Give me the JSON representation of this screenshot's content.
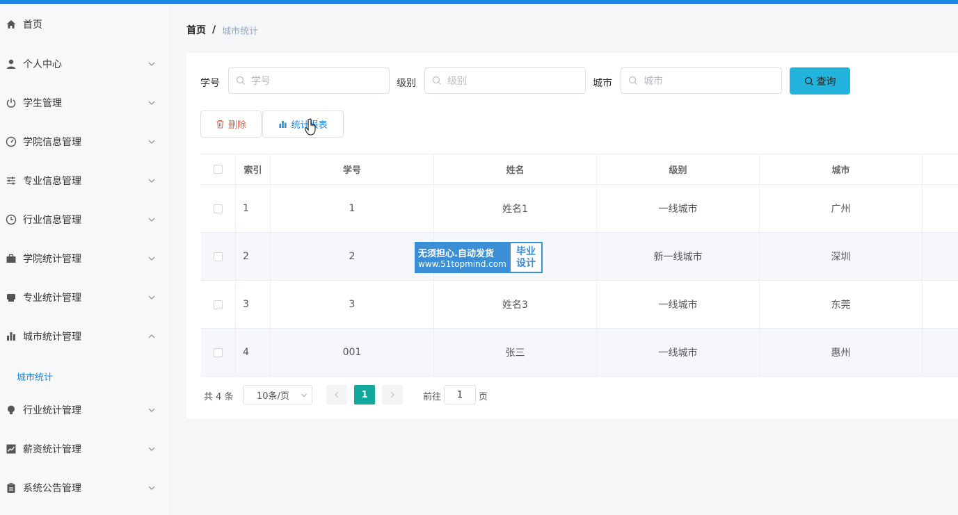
{
  "sidebar": {
    "items": [
      {
        "label": "首页",
        "icon": "home-icon"
      },
      {
        "label": "个人中心",
        "icon": "user-icon"
      },
      {
        "label": "学生管理",
        "icon": "power-icon"
      },
      {
        "label": "学院信息管理",
        "icon": "dashboard-icon"
      },
      {
        "label": "专业信息管理",
        "icon": "sliders-icon"
      },
      {
        "label": "行业信息管理",
        "icon": "clock-icon"
      },
      {
        "label": "学院统计管理",
        "icon": "briefcase-icon"
      },
      {
        "label": "专业统计管理",
        "icon": "printer-icon"
      },
      {
        "label": "城市统计管理",
        "icon": "bar-chart-icon"
      },
      {
        "label": "行业统计管理",
        "icon": "bulb-icon"
      },
      {
        "label": "薪资统计管理",
        "icon": "line-chart-icon"
      },
      {
        "label": "系统公告管理",
        "icon": "clipboard-icon"
      }
    ],
    "sub_item": "城市统计"
  },
  "breadcrumb": {
    "home": "首页",
    "separator": "/",
    "current": "城市统计"
  },
  "search": {
    "student_id_label": "学号",
    "student_id_placeholder": "学号",
    "level_label": "级别",
    "level_placeholder": "级别",
    "city_label": "城市",
    "city_placeholder": "城市",
    "query_button": "查询"
  },
  "actions": {
    "delete_button": "删除",
    "stats_button": "统计报表"
  },
  "table": {
    "headers": {
      "index": "索引",
      "student_id": "学号",
      "name": "姓名",
      "level": "级别",
      "city": "城市"
    },
    "rows": [
      {
        "index": "1",
        "student_id": "1",
        "name": "姓名1",
        "level": "一线城市",
        "city": "广州"
      },
      {
        "index": "2",
        "student_id": "2",
        "name": "",
        "level": "新一线城市",
        "city": "深圳"
      },
      {
        "index": "3",
        "student_id": "3",
        "name": "姓名3",
        "level": "一线城市",
        "city": "东莞"
      },
      {
        "index": "4",
        "student_id": "001",
        "name": "张三",
        "level": "一线城市",
        "city": "惠州"
      }
    ]
  },
  "pagination": {
    "total": "共 4 条",
    "page_size": "10条/页",
    "current_page": "1",
    "goto_label": "前往",
    "goto_value": "1",
    "page_suffix": "页"
  },
  "watermark": {
    "line1": "无须担心.自动发货",
    "line2": "www.51topmind.com",
    "badge1": "毕业",
    "badge2": "设计"
  },
  "colors": {
    "accent": "#1e88e5",
    "query_button": "#22b3dc",
    "active_page": "#13a89e",
    "delete": "#e55f4a"
  }
}
